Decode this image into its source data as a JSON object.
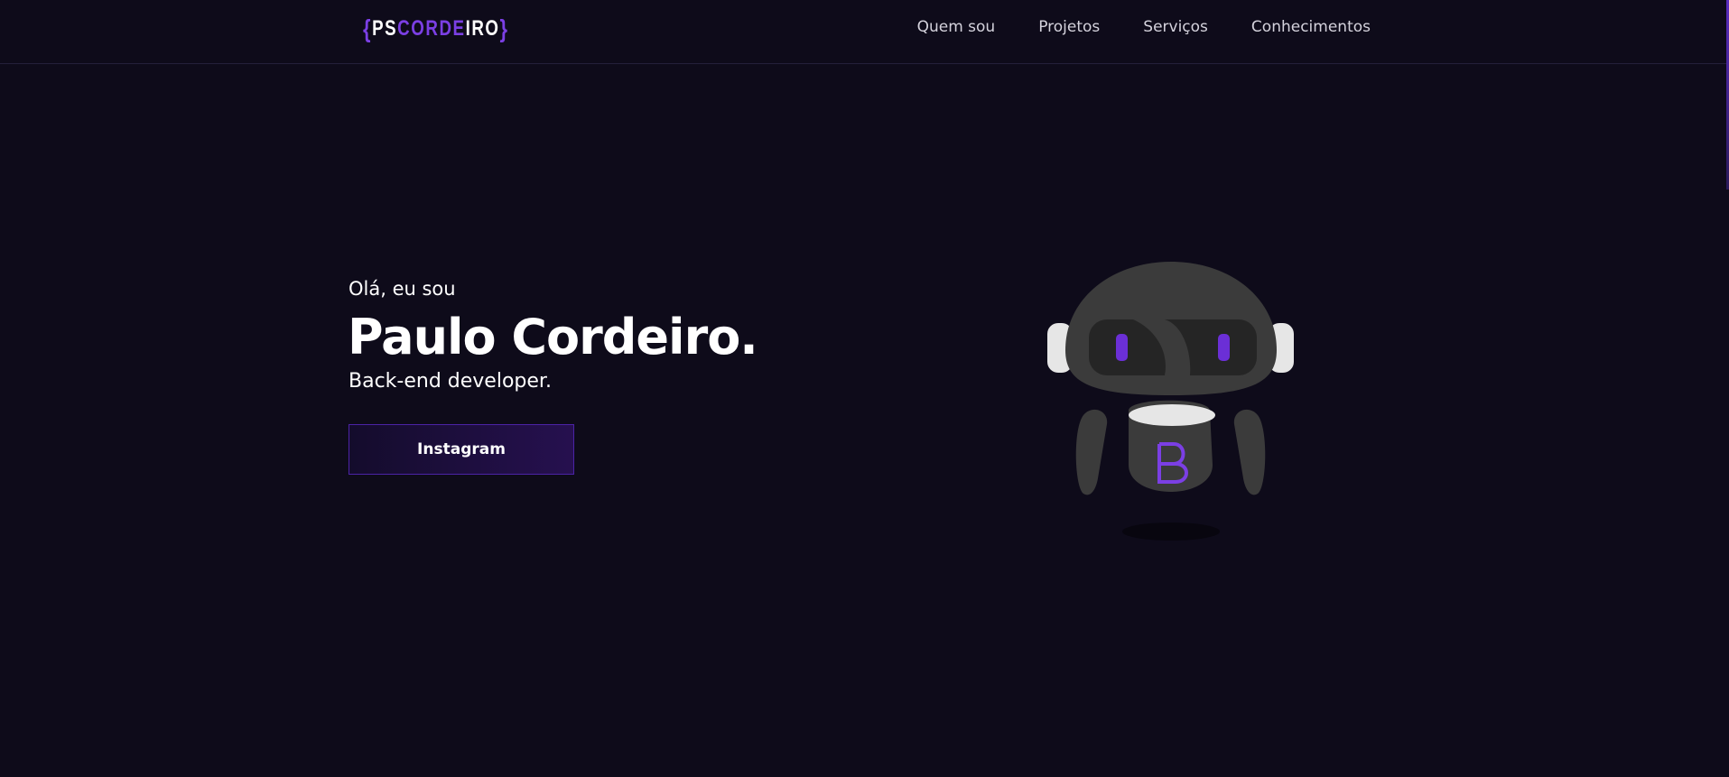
{
  "header": {
    "logo": {
      "open_brace": "{",
      "part1": "PS",
      "part2": "COR",
      "part3": "DE",
      "part4": "IRO",
      "close_brace": "}"
    },
    "nav": [
      "Quem sou",
      "Projetos",
      "Serviços",
      "Conhecimentos"
    ]
  },
  "hero": {
    "greeting": "Olá, eu sou",
    "name": "Paulo Cordeiro.",
    "role": "Back-end developer.",
    "button_label": "Instagram"
  },
  "colors": {
    "background": "#0e0b1a",
    "accent": "#7b3fe4",
    "robot_body": "#3b3b3b"
  },
  "icons": {
    "robot": "robot-illustration",
    "robot_logo": "b-letter-icon"
  }
}
